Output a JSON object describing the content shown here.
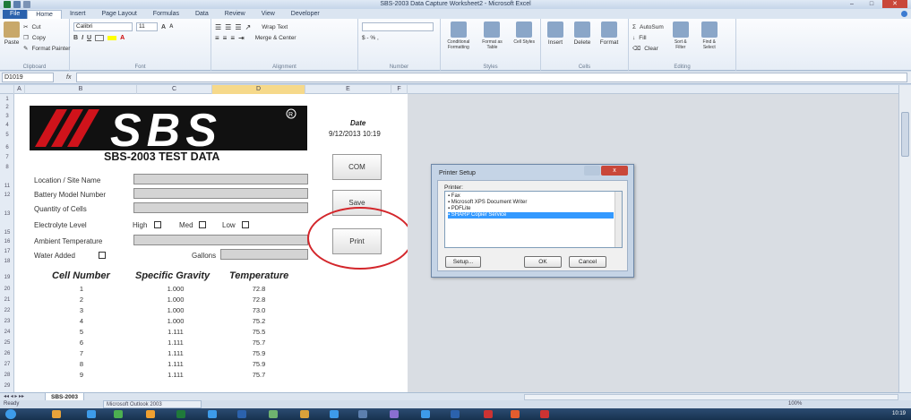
{
  "window": {
    "title": "SBS-2003 Data Capture Worksheet2 - Microsoft Excel"
  },
  "ribbon_tabs": [
    "File",
    "Home",
    "Insert",
    "Page Layout",
    "Formulas",
    "Data",
    "Review",
    "View",
    "Developer"
  ],
  "active_tab": "Home",
  "clipboard": {
    "cut": "Cut",
    "copy": "Copy",
    "paste": "Paste",
    "format_painter": "Format Painter",
    "label": "Clipboard"
  },
  "font": {
    "name": "Calibri",
    "size": "11",
    "bold": "B",
    "italic": "I",
    "underline": "U",
    "label": "Font"
  },
  "alignment": {
    "wrap": "Wrap Text",
    "merge": "Merge & Center",
    "label": "Alignment"
  },
  "number": {
    "format": "$ - % ,",
    "label": "Number"
  },
  "styles": {
    "conditional": "Conditional Formatting",
    "format_table": "Format as Table",
    "cell_styles": "Cell Styles",
    "label": "Styles"
  },
  "cells": {
    "insert": "Insert",
    "delete": "Delete",
    "format": "Format",
    "label": "Cells"
  },
  "editing": {
    "autosum": "AutoSum",
    "fill": "Fill",
    "clear": "Clear",
    "sort": "Sort & Filter",
    "find": "Find & Select",
    "label": "Editing"
  },
  "formula_bar": {
    "name_box": "D1019",
    "fx": "fx",
    "value": ""
  },
  "columns": [
    "A",
    "B",
    "C",
    "D",
    "E",
    "F"
  ],
  "rows": [
    "1",
    "2",
    "3",
    "4",
    "5",
    "6",
    "7",
    "8",
    "11",
    "12",
    "13",
    "15",
    "16",
    "17",
    "18",
    "19",
    "20",
    "21",
    "22",
    "23",
    "24",
    "25",
    "26",
    "27",
    "28",
    "29"
  ],
  "form": {
    "logo_text": "SBS",
    "subtitle": "SBS-2003  TEST DATA",
    "date_label": "Date",
    "date_value": "9/12/2013 10:19",
    "fields": [
      "Location / Site Name",
      "Battery Model Number",
      "Quantity of Cells"
    ],
    "electrolyte_label": "Electrolyte Level",
    "levels": [
      "High",
      "Med",
      "Low"
    ],
    "ambient_label": "Ambient Temperature",
    "water_label": "Water Added",
    "gallons_label": "Gallons",
    "buttons": {
      "com": "COM",
      "save": "Save",
      "print": "Print"
    },
    "table_headers": [
      "Cell Number",
      "Specific Gravity",
      "Temperature"
    ],
    "table_rows": [
      [
        "1",
        "1.000",
        "72.8"
      ],
      [
        "2",
        "1.000",
        "72.8"
      ],
      [
        "3",
        "1.000",
        "73.0"
      ],
      [
        "4",
        "1.000",
        "75.2"
      ],
      [
        "5",
        "1.111",
        "75.5"
      ],
      [
        "6",
        "1.111",
        "75.7"
      ],
      [
        "7",
        "1.111",
        "75.9"
      ],
      [
        "8",
        "1.111",
        "75.9"
      ],
      [
        "9",
        "1.111",
        "75.7"
      ]
    ]
  },
  "dialog": {
    "title": "Printer Setup",
    "close": "x",
    "printer_label": "Printer:",
    "printers": [
      "Fax",
      "Microsoft XPS Document Writer",
      "PDFLite",
      "SHARP Copier Service"
    ],
    "selected_printer": "SHARP Copier Service",
    "setup": "Setup...",
    "ok": "OK",
    "cancel": "Cancel"
  },
  "sheet_tab": "SBS-2003",
  "status": {
    "ready": "Ready",
    "outlook": "Microsoft Outlook 2003",
    "zoom": "100%"
  },
  "taskbar": {
    "clock": "10:19"
  },
  "colors": {
    "excel_blue": "#2b62ad",
    "highlight_red": "#d3262b",
    "selection": "#3399ff"
  }
}
